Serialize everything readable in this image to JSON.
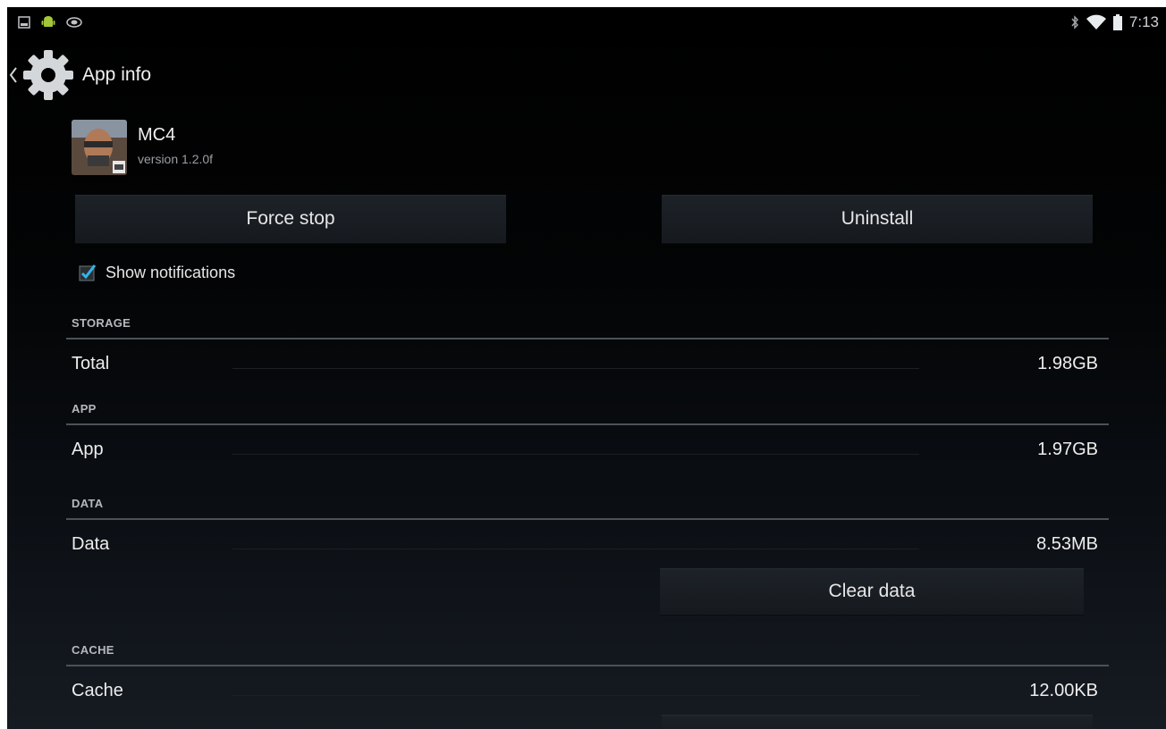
{
  "status_bar": {
    "left_icons": [
      "gallery-icon",
      "android-debug-icon",
      "nvidia-icon"
    ],
    "right_icons": [
      "bluetooth-icon",
      "wifi-icon",
      "battery-icon"
    ],
    "time": "7:13"
  },
  "action_bar": {
    "title": "App info",
    "icon": "settings-gear-icon"
  },
  "app": {
    "name": "MC4",
    "version": "version 1.2.0f"
  },
  "buttons": {
    "force_stop": "Force stop",
    "uninstall": "Uninstall",
    "clear_data": "Clear data"
  },
  "notifications": {
    "label": "Show notifications",
    "checked": true
  },
  "storage": {
    "header": "STORAGE",
    "total_label": "Total",
    "total_value": "1.98GB"
  },
  "app_section": {
    "header": "APP",
    "label": "App",
    "value": "1.97GB"
  },
  "data_section": {
    "header": "DATA",
    "label": "Data",
    "value": "8.53MB"
  },
  "cache_section": {
    "header": "CACHE",
    "label": "Cache",
    "value": "12.00KB"
  },
  "colors": {
    "accent": "#33b5e5",
    "background": "#000000",
    "divider": "#4c5258"
  }
}
